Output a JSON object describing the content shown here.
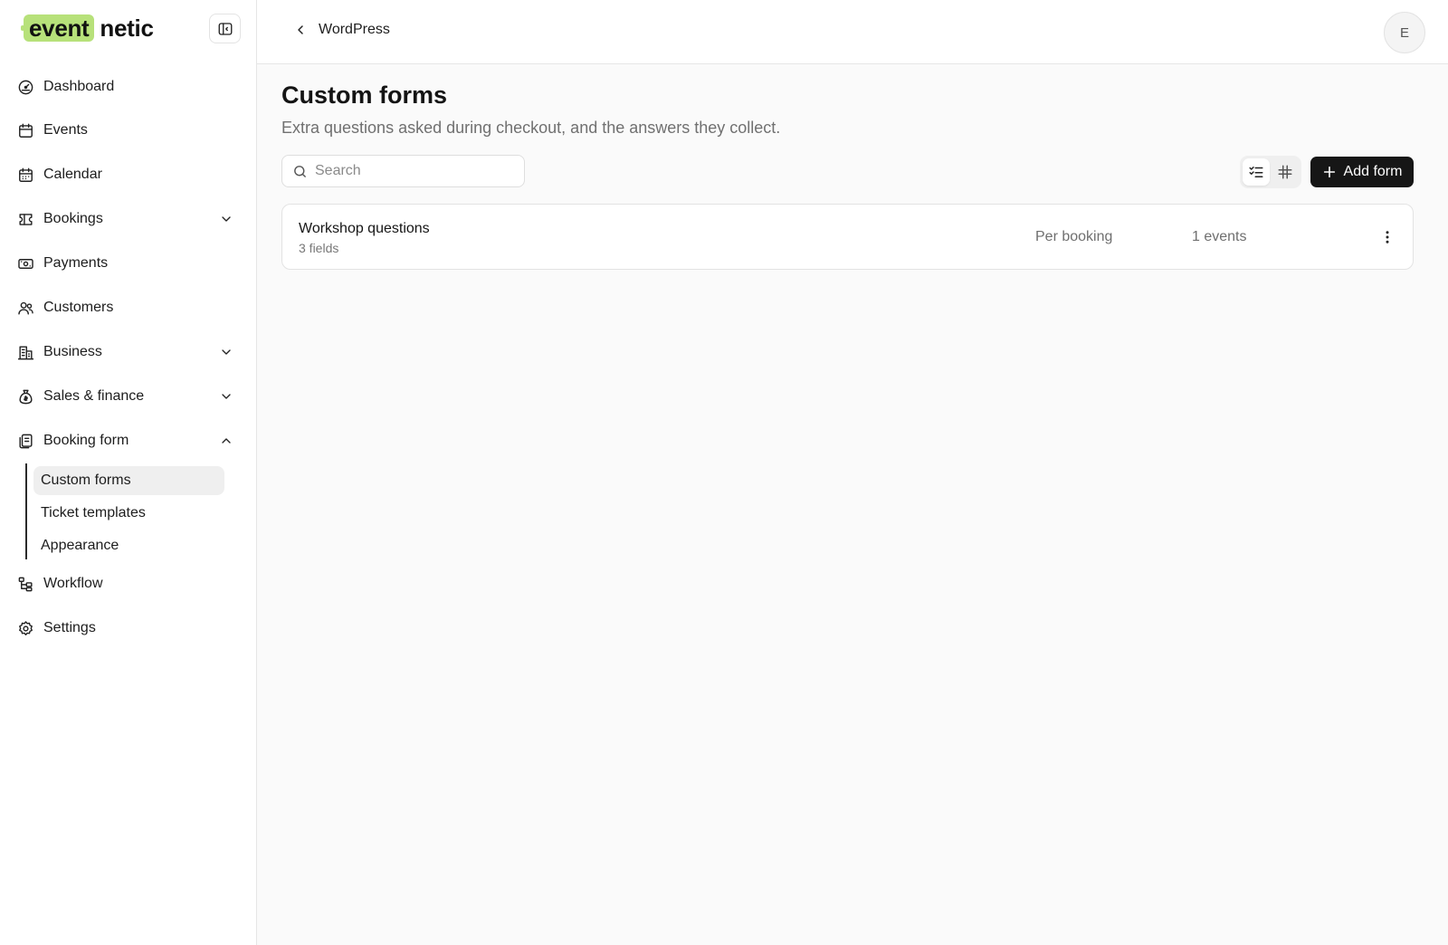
{
  "brand": {
    "highlight": "event",
    "rest": "netic",
    "accent_color": "#b7e17a"
  },
  "sidebar": {
    "items": [
      {
        "key": "dashboard",
        "label": "Dashboard",
        "icon": "dashboard-icon"
      },
      {
        "key": "events",
        "label": "Events",
        "icon": "calendar-icon"
      },
      {
        "key": "calendar",
        "label": "Calendar",
        "icon": "calendar-days-icon"
      },
      {
        "key": "bookings",
        "label": "Bookings",
        "icon": "ticket-icon",
        "expandable": true
      },
      {
        "key": "payments",
        "label": "Payments",
        "icon": "banknote-icon"
      },
      {
        "key": "customers",
        "label": "Customers",
        "icon": "users-icon"
      },
      {
        "key": "business",
        "label": "Business",
        "icon": "building-icon",
        "expandable": true
      },
      {
        "key": "sales",
        "label": "Sales & finance",
        "icon": "money-bag-icon",
        "expandable": true
      },
      {
        "key": "booking_form",
        "label": "Booking form",
        "icon": "form-icon",
        "expandable": true,
        "expanded": true
      },
      {
        "key": "workflow",
        "label": "Workflow",
        "icon": "workflow-icon"
      },
      {
        "key": "settings",
        "label": "Settings",
        "icon": "gear-icon"
      }
    ],
    "booking_form_children": [
      {
        "label": "Custom forms",
        "active": true
      },
      {
        "label": "Ticket templates"
      },
      {
        "label": "Appearance"
      }
    ]
  },
  "topbar": {
    "back_label": "WordPress",
    "avatar_initial": "E"
  },
  "page": {
    "title": "Custom forms",
    "subtitle": "Extra questions asked during checkout, and the answers they collect.",
    "search_placeholder": "Search",
    "view_modes": [
      "list",
      "grid"
    ],
    "active_view": "list",
    "add_label": "Add form"
  },
  "forms": [
    {
      "name": "Workshop questions",
      "fields": "3 fields",
      "scope": "Per booking",
      "events": "1 events"
    }
  ]
}
